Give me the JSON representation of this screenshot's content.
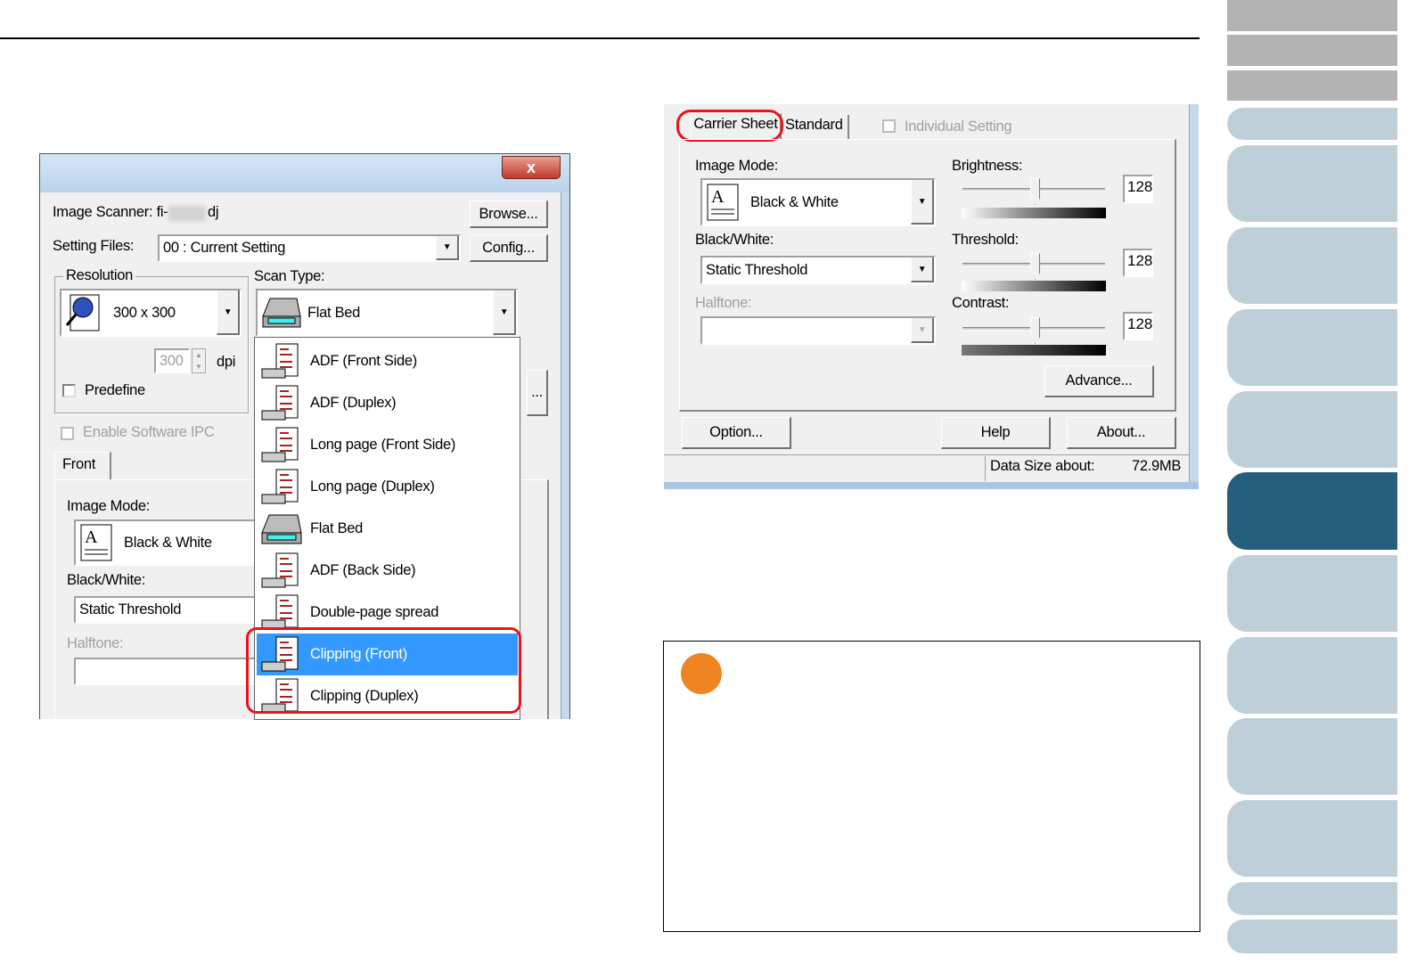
{
  "left_dialog": {
    "close_label": "x",
    "image_scanner_label": "Image Scanner: fi-",
    "image_scanner_suffix": "dj",
    "browse_button": "Browse...",
    "setting_files_label": "Setting Files:",
    "setting_files_value": "00 : Current Setting",
    "config_button": "Config...",
    "resolution_label": "Resolution",
    "resolution_value": "300 x 300",
    "dpi_value": "300",
    "dpi_label": "dpi",
    "predefine_label": "Predefine",
    "scan_type_label": "Scan Type:",
    "scan_type_value": "Flat Bed",
    "more_button": "...",
    "enable_ipc_label": "Enable Software IPC",
    "front_tab": "Front",
    "image_mode_label": "Image Mode:",
    "image_mode_value": "Black & White",
    "bw_label": "Black/White:",
    "bw_value": "Static Threshold",
    "halftone_label": "Halftone:",
    "scan_type_options": [
      {
        "label": "ADF (Front Side)",
        "icon": "adf-front-icon"
      },
      {
        "label": "ADF (Duplex)",
        "icon": "adf-duplex-icon"
      },
      {
        "label": "Long page (Front Side)",
        "icon": "long-page-front-icon"
      },
      {
        "label": "Long page (Duplex)",
        "icon": "long-page-duplex-icon"
      },
      {
        "label": "Flat Bed",
        "icon": "flatbed-icon"
      },
      {
        "label": "ADF (Back Side)",
        "icon": "adf-back-icon"
      },
      {
        "label": "Double-page spread",
        "icon": "double-page-icon"
      },
      {
        "label": "Clipping (Front)",
        "icon": "clipping-front-icon",
        "selected": true
      },
      {
        "label": "Clipping (Duplex)",
        "icon": "clipping-duplex-icon"
      }
    ]
  },
  "right_dialog": {
    "tabs": [
      "Carrier Sheet",
      "Standard"
    ],
    "individual_setting_label": "Individual Setting",
    "image_mode_label": "Image Mode:",
    "image_mode_value": "Black & White",
    "bw_label": "Black/White:",
    "bw_value": "Static Threshold",
    "halftone_label": "Halftone:",
    "brightness_label": "Brightness:",
    "brightness_value": "128",
    "threshold_label": "Threshold:",
    "threshold_value": "128",
    "contrast_label": "Contrast:",
    "contrast_value": "128",
    "slider_fraction": 0.5,
    "advance_button": "Advance...",
    "option_button": "Option...",
    "help_button": "Help",
    "about_button": "About...",
    "data_size_label": "Data Size about:",
    "data_size_value": "72.9MB"
  },
  "colors": {
    "accent_active_tab": "#265f7e",
    "tab": "#bfcfd9",
    "highlight": "#e8141c",
    "note_dot": "#ee8522",
    "selection": "#3399ff"
  }
}
